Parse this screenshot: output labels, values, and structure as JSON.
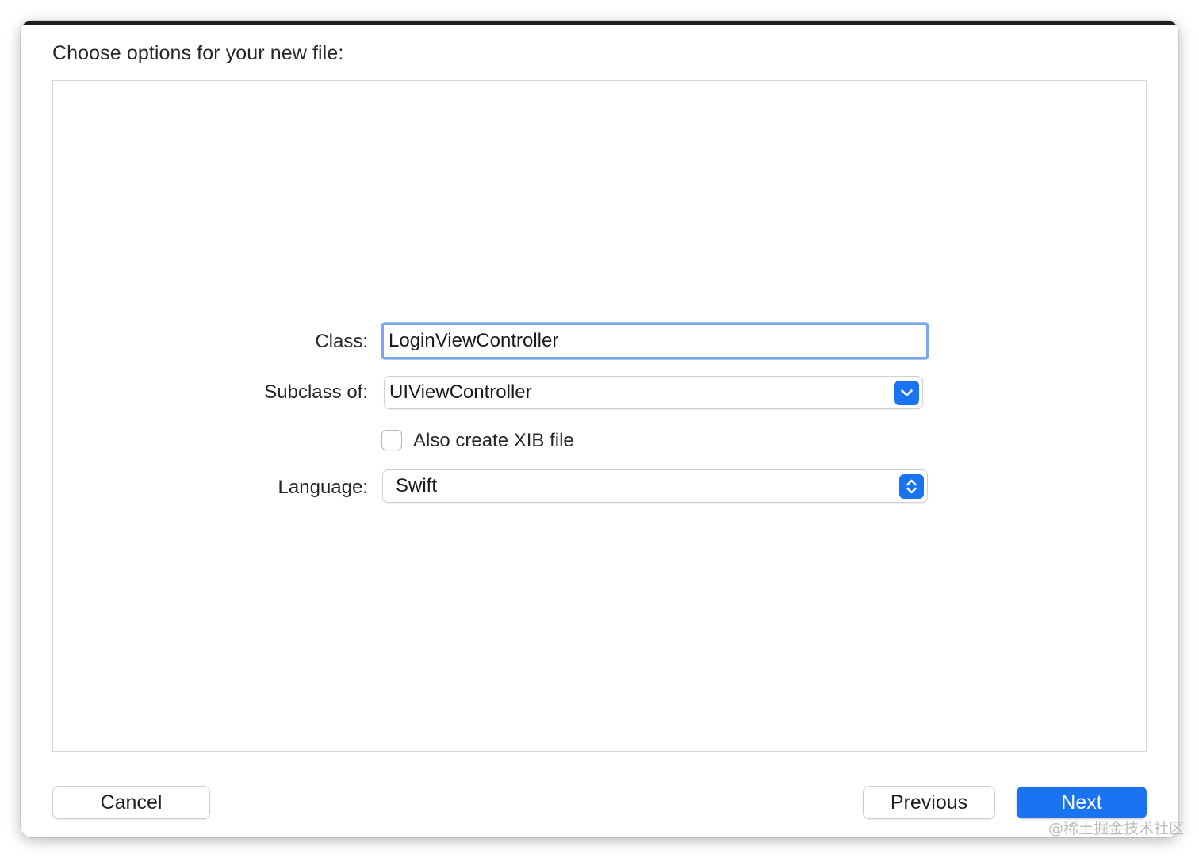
{
  "dialog": {
    "title": "Choose options for your new file:"
  },
  "form": {
    "class_label": "Class:",
    "class_value": "LoginViewController",
    "subclass_label": "Subclass of:",
    "subclass_value": "UIViewController",
    "xib_checkbox_label": "Also create XIB file",
    "xib_checked": false,
    "language_label": "Language:",
    "language_value": "Swift"
  },
  "buttons": {
    "cancel": "Cancel",
    "previous": "Previous",
    "next": "Next"
  },
  "watermark": "@稀土掘金技术社区",
  "colors": {
    "accent": "#1a73f0",
    "focus_ring": "#7aa7ec"
  },
  "icons": {
    "subclass_popup": "chevron-down-icon",
    "language_popup": "chevron-up-down-icon"
  }
}
